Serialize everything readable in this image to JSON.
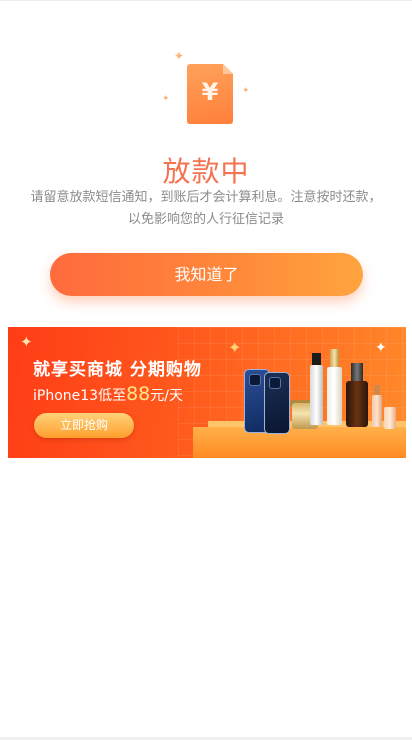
{
  "status": {
    "icon": "yuan-document-icon",
    "currency_symbol": "¥",
    "title": "放款中",
    "description": "请留意放款短信通知，到账后才会计算利息。注意按时还款，以免影响您的人行征信记录"
  },
  "actions": {
    "confirm_label": "我知道了"
  },
  "promo_banner": {
    "headline": "就享买商城 分期购物",
    "subline_prefix": "iPhone13低至",
    "subline_price": "88",
    "subline_suffix": "元/天",
    "cta_label": "立即抢购",
    "illustration": "phones-and-cosmetics-icon"
  },
  "colors": {
    "accent": "#f37350",
    "button_gradient_start": "#ff6a3d",
    "button_gradient_end": "#ffa43e",
    "banner_red": "#ff3c17",
    "banner_orange": "#ff8a2a",
    "text_muted": "#8b8b8b"
  }
}
